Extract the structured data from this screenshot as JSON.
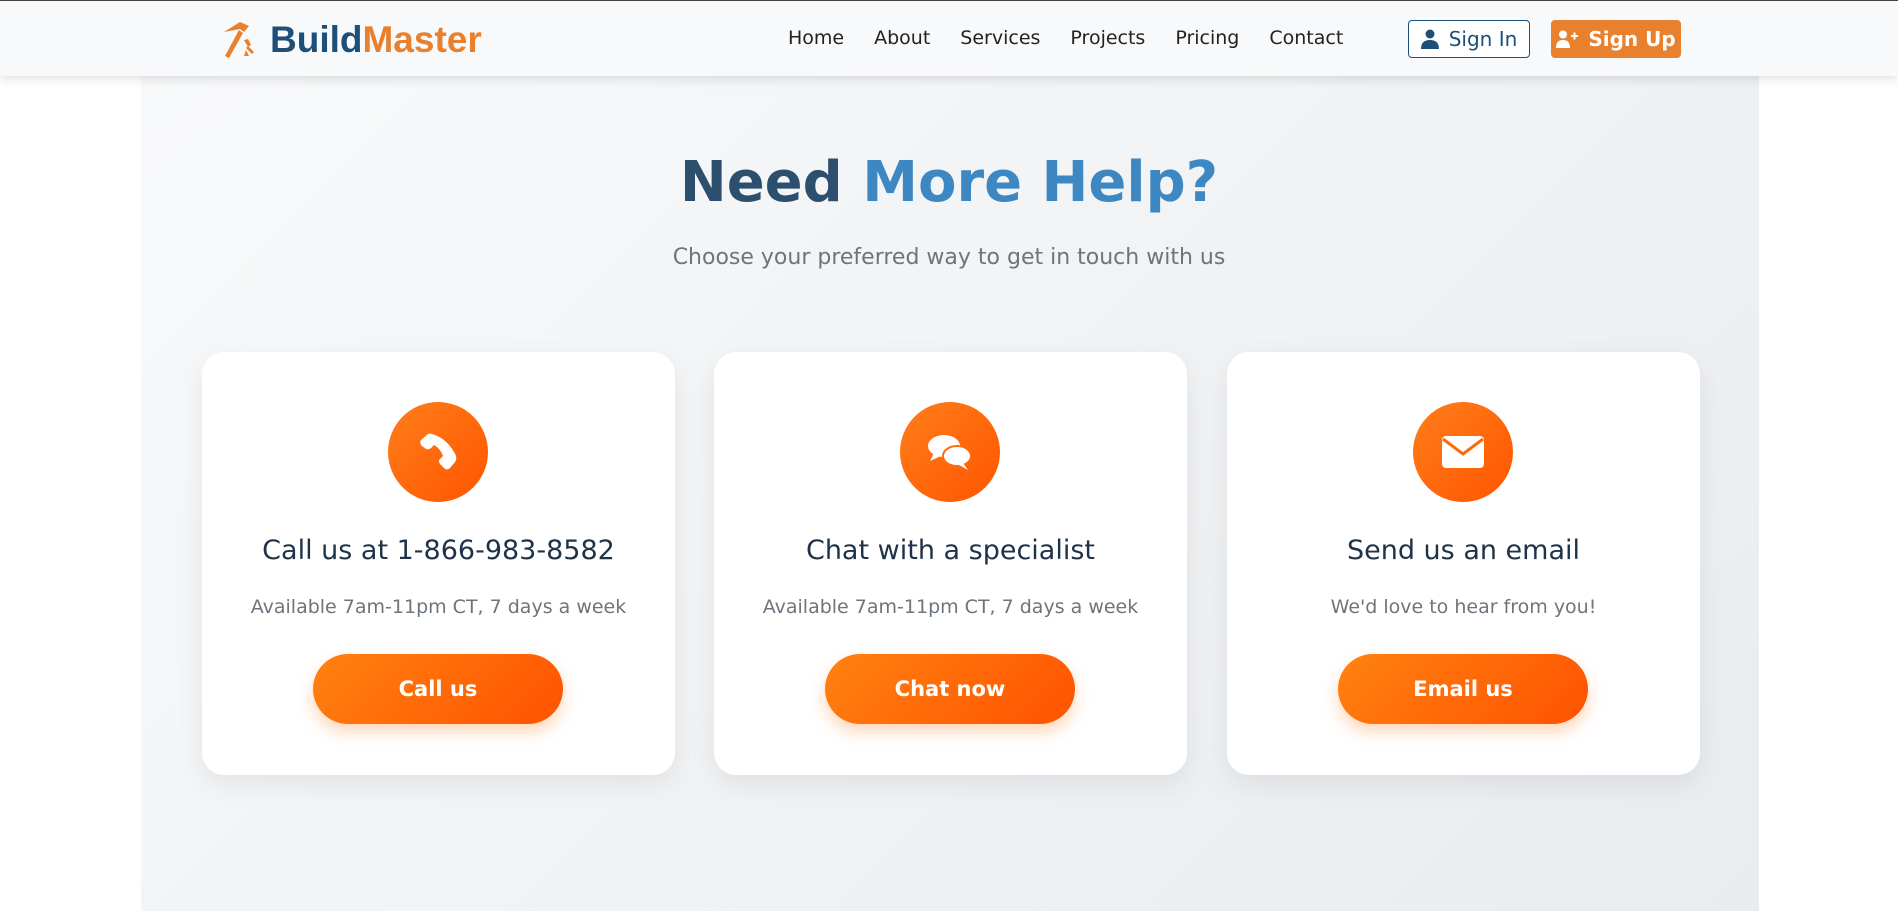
{
  "brand": {
    "name_part1": "Build",
    "name_part2": "Master",
    "logo_icon": "hammer-icon",
    "colors": {
      "primary": "#1e4f78",
      "accent": "#e8802d"
    }
  },
  "nav": {
    "links": [
      "Home",
      "About",
      "Services",
      "Projects",
      "Pricing",
      "Contact"
    ],
    "signin_label": "Sign In",
    "signup_label": "Sign Up"
  },
  "hero": {
    "title_part1": "Need",
    "title_part2": "More Help?",
    "subtitle": "Choose your preferred way to get in touch with us"
  },
  "cards": [
    {
      "icon": "phone-icon",
      "title": "Call us at 1-866-983-8582",
      "description": "Available 7am-11pm CT, 7 days a week",
      "button": "Call us"
    },
    {
      "icon": "chat-icon",
      "title": "Chat with a specialist",
      "description": "Available 7am-11pm CT, 7 days a week",
      "button": "Chat now"
    },
    {
      "icon": "envelope-icon",
      "title": "Send us an email",
      "description": "We'd love to hear from you!",
      "button": "Email us"
    }
  ],
  "colors": {
    "button_gradient_start": "#ff8210",
    "button_gradient_end": "#ff5200",
    "heading_dark": "#2c4f6e",
    "heading_light": "#3d87c2"
  }
}
